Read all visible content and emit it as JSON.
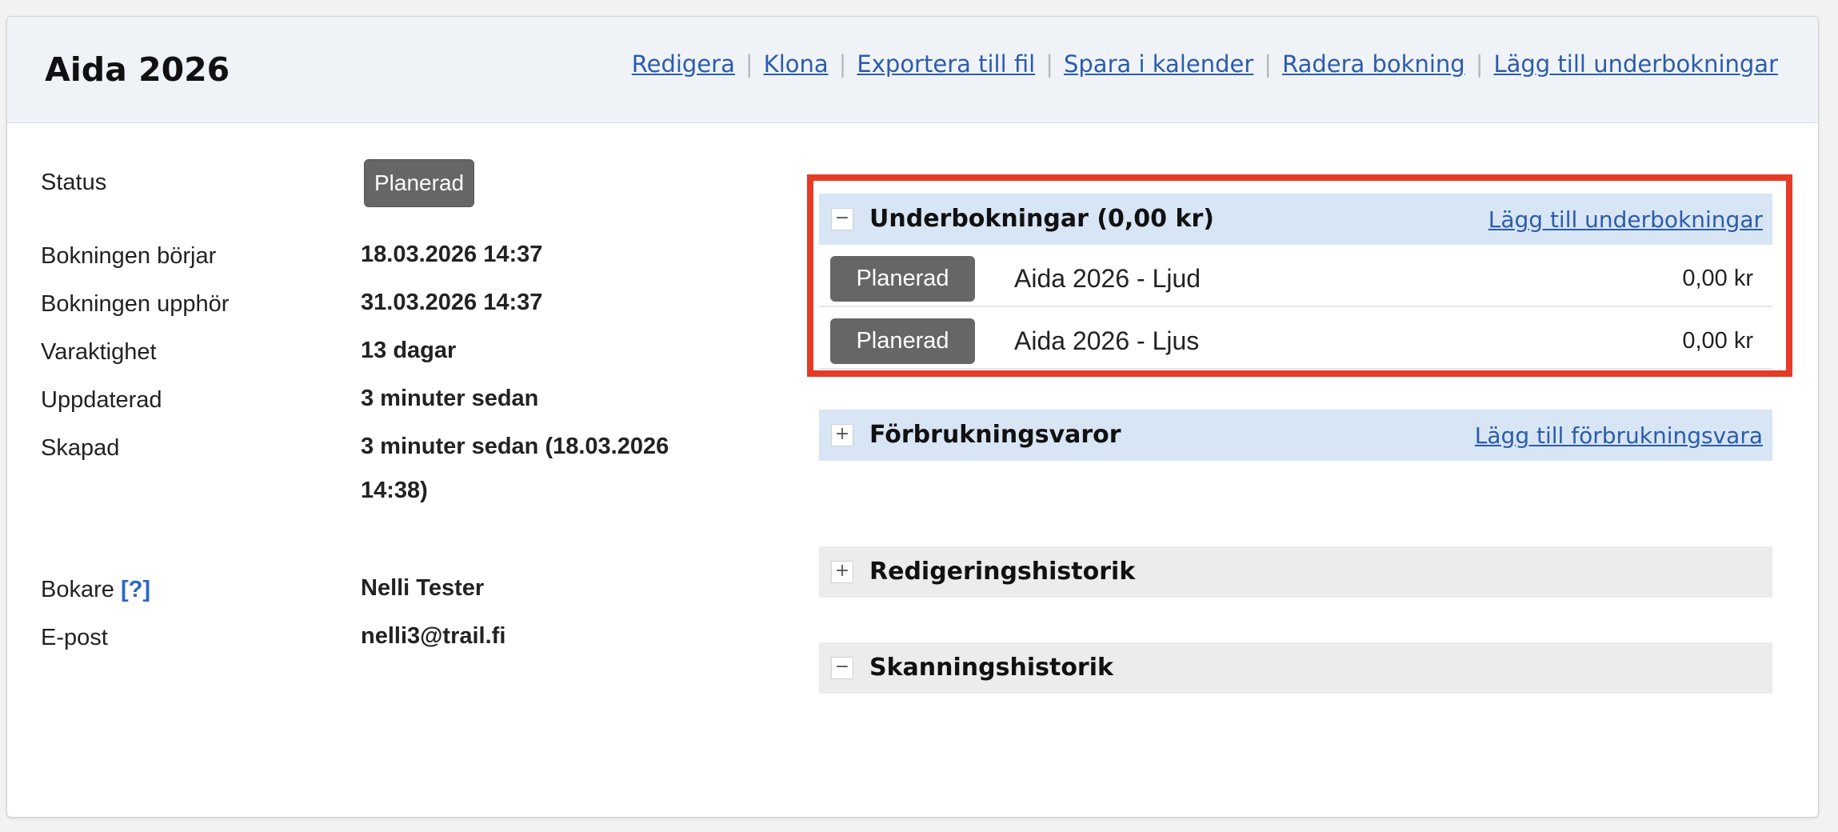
{
  "booking": {
    "title": "Aida 2026",
    "actions": [
      "Redigera",
      "Klona",
      "Exportera till fil",
      "Spara i kalender",
      "Radera bokning",
      "Lägg till underbokningar"
    ]
  },
  "details": {
    "status_label": "Status",
    "status_value": "Planerad",
    "start_label": "Bokningen börjar",
    "start_value": "18.03.2026 14:37",
    "end_label": "Bokningen upphör",
    "end_value": "31.03.2026 14:37",
    "duration_label": "Varaktighet",
    "duration_value": "13 dagar",
    "updated_label": "Uppdaterad",
    "updated_value": "3 minuter sedan",
    "created_label": "Skapad",
    "created_value_line1": "3 minuter sedan (18.03.2026",
    "created_value_line2": "14:38)",
    "booker_label": "Bokare",
    "booker_help": "[?]",
    "booker_value": "Nelli Tester",
    "email_label": "E-post",
    "email_value": "nelli3@trail.fi"
  },
  "panels": {
    "subbookings": {
      "toggle": "−",
      "title": "Underbokningar (0,00 kr)",
      "link": "Lägg till underbokningar",
      "rows": [
        {
          "status": "Planerad",
          "name": "Aida 2026 - Ljud",
          "price": "0,00 kr"
        },
        {
          "status": "Planerad",
          "name": "Aida 2026 - Ljus",
          "price": "0,00 kr"
        }
      ]
    },
    "consumables": {
      "toggle": "+",
      "title": "Förbrukningsvaror",
      "link": "Lägg till förbrukningsvara"
    },
    "history": {
      "toggle": "+",
      "title": "Redigeringshistorik"
    },
    "scan": {
      "toggle": "−",
      "title": "Skanningshistorik"
    }
  },
  "colors": {
    "header_bg": "#eff3f8",
    "panel_blue": "#d7e5f5",
    "panel_grey": "#ececec",
    "badge_grey": "#666666",
    "link_blue": "#2c5cab",
    "highlight_red": "#e53a26"
  }
}
